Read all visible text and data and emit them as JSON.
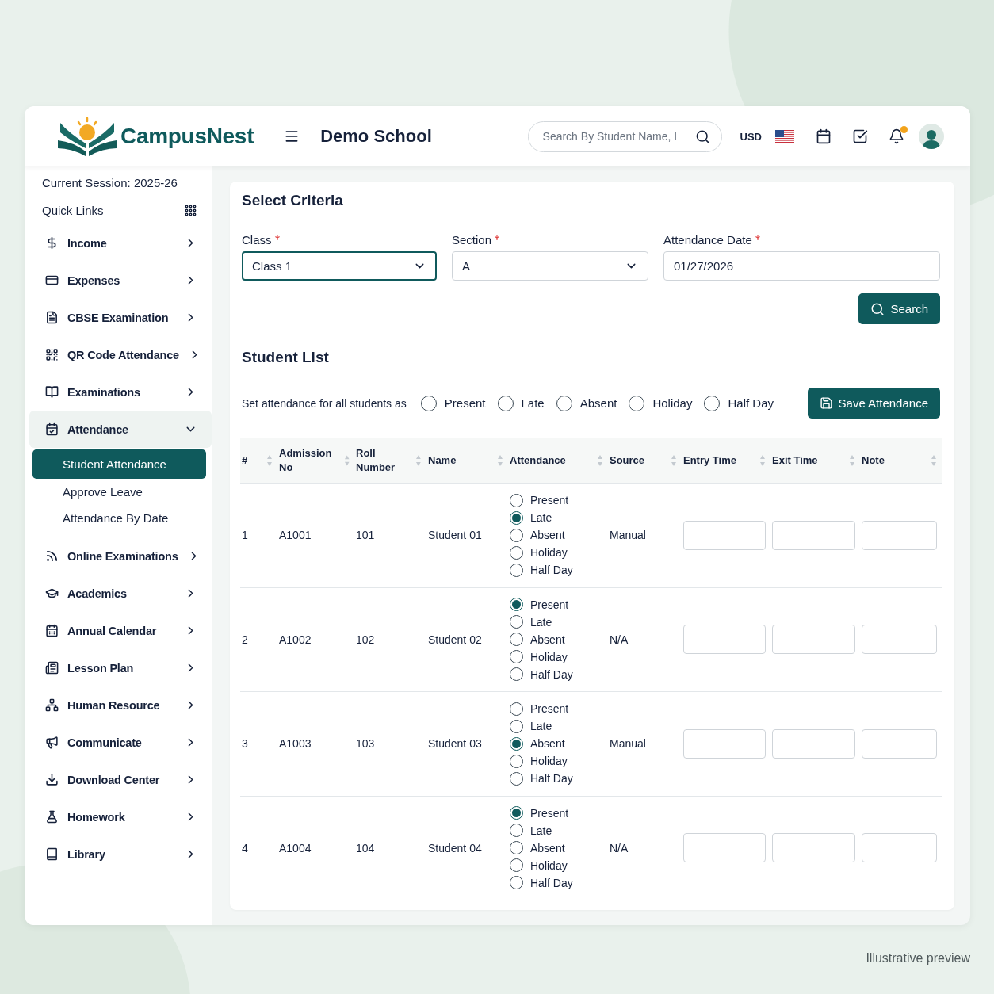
{
  "header": {
    "brand": "CampusNest",
    "school": "Demo School",
    "search": {
      "placeholder": "Search By Student Name, I"
    },
    "currency": "USD",
    "notification_unread": true
  },
  "sidebar": {
    "session": "Current Session: 2025-26",
    "quick_links": "Quick Links",
    "items": [
      {
        "label": "Income",
        "expanded": false
      },
      {
        "label": "Expenses",
        "expanded": false
      },
      {
        "label": "CBSE Examination",
        "expanded": false
      },
      {
        "label": "QR Code Attendance",
        "expanded": false
      },
      {
        "label": "Examinations",
        "expanded": false
      },
      {
        "label": "Attendance",
        "expanded": true,
        "children": [
          {
            "label": "Student Attendance",
            "selected": true
          },
          {
            "label": "Approve Leave",
            "selected": false
          },
          {
            "label": "Attendance By Date",
            "selected": false
          }
        ]
      },
      {
        "label": "Online Examinations",
        "expanded": false
      },
      {
        "label": "Academics",
        "expanded": false
      },
      {
        "label": "Annual Calendar",
        "expanded": false
      },
      {
        "label": "Lesson Plan",
        "expanded": false
      },
      {
        "label": "Human Resource",
        "expanded": false
      },
      {
        "label": "Communicate",
        "expanded": false
      },
      {
        "label": "Download Center",
        "expanded": false
      },
      {
        "label": "Homework",
        "expanded": false
      },
      {
        "label": "Library",
        "expanded": false
      }
    ]
  },
  "criteria": {
    "title": "Select Criteria",
    "fields": [
      {
        "label": "Class",
        "required": true,
        "kind": "select",
        "value": "Class 1",
        "focused": true
      },
      {
        "label": "Section",
        "required": true,
        "kind": "select",
        "value": "A",
        "focused": false
      },
      {
        "label": "Attendance Date",
        "required": true,
        "kind": "date",
        "value": "01/27/2026",
        "focused": false
      }
    ],
    "search_button": "Search"
  },
  "student_list": {
    "title": "Student List",
    "bulk_label": "Set attendance for all students as",
    "bulk_options": [
      {
        "label": "Present",
        "selected": false
      },
      {
        "label": "Late",
        "selected": false
      },
      {
        "label": "Absent",
        "selected": false
      },
      {
        "label": "Holiday",
        "selected": false
      },
      {
        "label": "Half Day",
        "selected": false
      }
    ],
    "save_button": "Save Attendance",
    "columns": [
      "#",
      "Admission No",
      "Roll Number",
      "Name",
      "Attendance",
      "Source",
      "Entry Time",
      "Exit Time",
      "Note"
    ],
    "rows": [
      {
        "number": "1",
        "admission_no": "A1001",
        "roll_number": "101",
        "name": "Student 01",
        "source": "Manual",
        "attendance": [
          {
            "label": "Present",
            "selected": false
          },
          {
            "label": "Late",
            "selected": true
          },
          {
            "label": "Absent",
            "selected": false
          },
          {
            "label": "Holiday",
            "selected": false
          },
          {
            "label": "Half Day",
            "selected": false
          }
        ]
      },
      {
        "number": "2",
        "admission_no": "A1002",
        "roll_number": "102",
        "name": "Student 02",
        "source": "N/A",
        "attendance": [
          {
            "label": "Present",
            "selected": true
          },
          {
            "label": "Late",
            "selected": false
          },
          {
            "label": "Absent",
            "selected": false
          },
          {
            "label": "Holiday",
            "selected": false
          },
          {
            "label": "Half Day",
            "selected": false
          }
        ]
      },
      {
        "number": "3",
        "admission_no": "A1003",
        "roll_number": "103",
        "name": "Student 03",
        "source": "Manual",
        "attendance": [
          {
            "label": "Present",
            "selected": false
          },
          {
            "label": "Late",
            "selected": false
          },
          {
            "label": "Absent",
            "selected": true
          },
          {
            "label": "Holiday",
            "selected": false
          },
          {
            "label": "Half Day",
            "selected": false
          }
        ]
      },
      {
        "number": "4",
        "admission_no": "A1004",
        "roll_number": "104",
        "name": "Student 04",
        "source": "N/A",
        "attendance": [
          {
            "label": "Present",
            "selected": true
          },
          {
            "label": "Late",
            "selected": false
          },
          {
            "label": "Absent",
            "selected": false
          },
          {
            "label": "Holiday",
            "selected": false
          },
          {
            "label": "Half Day",
            "selected": false
          }
        ]
      }
    ]
  },
  "caption": "Illustrative preview"
}
